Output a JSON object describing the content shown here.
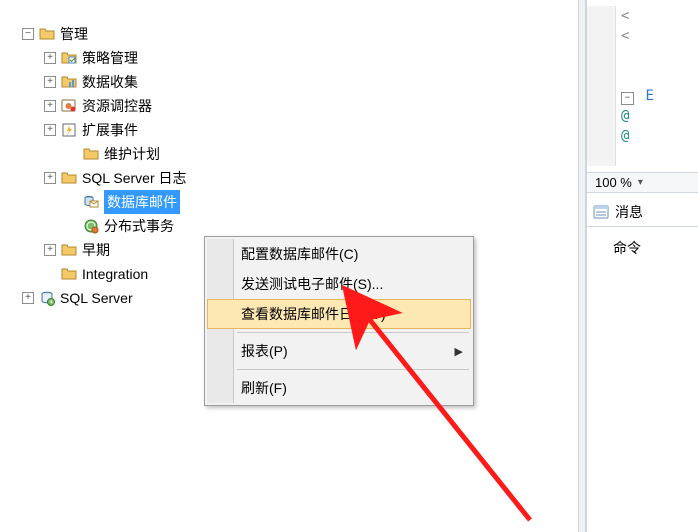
{
  "tree": {
    "root": {
      "label": "管理",
      "expand": "−"
    },
    "children": [
      {
        "label": "策略管理",
        "expand": "+",
        "icon": "folder-chart"
      },
      {
        "label": "数据收集",
        "expand": "+",
        "icon": "folder-chart"
      },
      {
        "label": "资源调控器",
        "expand": "+",
        "icon": "resource-gov"
      },
      {
        "label": "扩展事件",
        "expand": "+",
        "icon": "ext-events"
      },
      {
        "label": "维护计划",
        "expand": "",
        "icon": "folder"
      },
      {
        "label": "SQL Server 日志",
        "expand": "+",
        "icon": "folder"
      },
      {
        "label": "数据库邮件",
        "expand": "",
        "icon": "db-mail",
        "selected": true
      },
      {
        "label": "分布式事务",
        "expand": "",
        "icon": "dtc",
        "truncated": true
      },
      {
        "label": "早期",
        "expand": "+",
        "icon": "folder"
      }
    ],
    "extras": [
      {
        "label": "Integration",
        "expand": "",
        "icon": "folder",
        "truncated": true
      },
      {
        "label": "SQL Server",
        "expand": "+",
        "icon": "sql-agent",
        "truncated": true
      }
    ]
  },
  "menu": {
    "items": [
      {
        "id": "configure",
        "label": "配置数据库邮件(C)"
      },
      {
        "id": "sendtest",
        "label": "发送测试电子邮件(S)..."
      },
      {
        "id": "viewlog",
        "label": "查看数据库邮件日志(V)",
        "hover": true
      },
      {
        "sep": true
      },
      {
        "id": "reports",
        "label": "报表(P)",
        "submenu": true
      },
      {
        "sep": true
      },
      {
        "id": "refresh",
        "label": "刷新(F)"
      }
    ]
  },
  "right": {
    "code": {
      "l1": "<",
      "l2": "<",
      "l3_prefix": "E",
      "l4": "@",
      "l5": "@"
    },
    "zoom": "100 %",
    "tab": "消息",
    "extra": "命令"
  }
}
